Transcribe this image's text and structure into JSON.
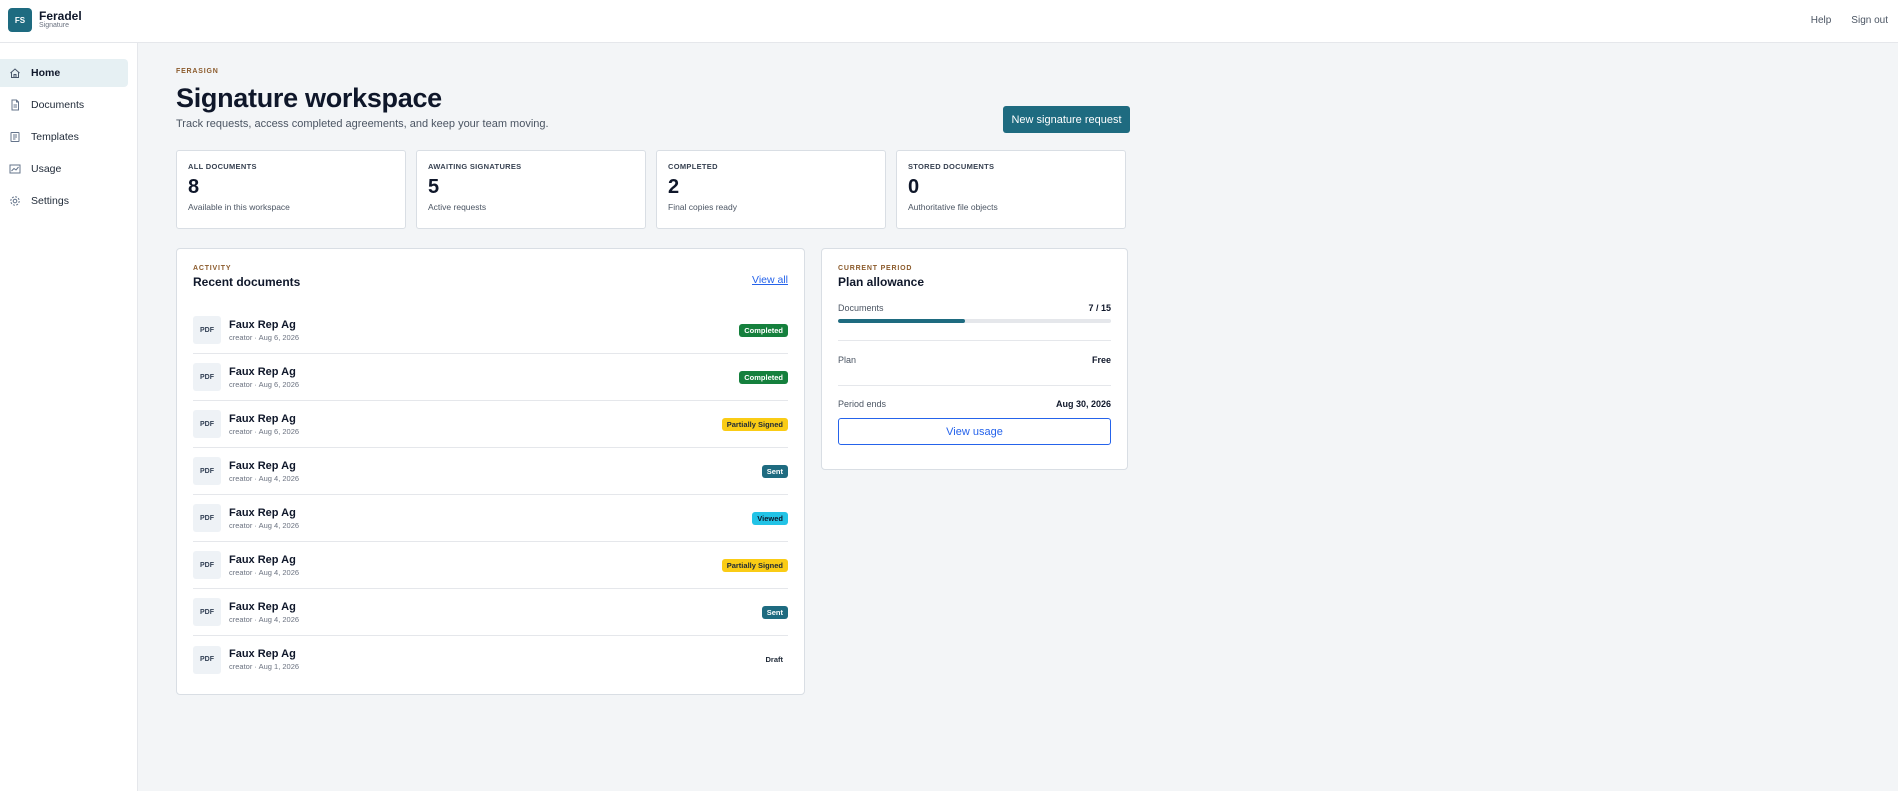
{
  "brand": {
    "logo": "FS",
    "name": "Feradel",
    "sub": "Signature"
  },
  "topnav": {
    "help": "Help",
    "signout": "Sign out"
  },
  "sidebar": {
    "items": [
      {
        "label": "Home",
        "icon": "home-icon",
        "active": true
      },
      {
        "label": "Documents",
        "icon": "document-icon",
        "active": false
      },
      {
        "label": "Templates",
        "icon": "template-icon",
        "active": false
      },
      {
        "label": "Usage",
        "icon": "chart-icon",
        "active": false
      },
      {
        "label": "Settings",
        "icon": "gear-icon",
        "active": false
      }
    ]
  },
  "header": {
    "eyebrow": "FERASIGN",
    "title": "Signature workspace",
    "subtitle": "Track requests, access completed agreements, and keep your team moving.",
    "new_button": "New signature request"
  },
  "stats": [
    {
      "label": "ALL DOCUMENTS",
      "value": "8",
      "caption": "Available in this workspace"
    },
    {
      "label": "AWAITING SIGNATURES",
      "value": "5",
      "caption": "Active requests"
    },
    {
      "label": "COMPLETED",
      "value": "2",
      "caption": "Final copies ready"
    },
    {
      "label": "STORED DOCUMENTS",
      "value": "0",
      "caption": "Authoritative file objects"
    }
  ],
  "activity": {
    "eyebrow": "ACTIVITY",
    "title": "Recent documents",
    "view_all": "View all",
    "documents": [
      {
        "icon": "PDF",
        "name": "Faux Rep Ag",
        "meta": "creator · Aug 6, 2026",
        "status": "Completed"
      },
      {
        "icon": "PDF",
        "name": "Faux Rep Ag",
        "meta": "creator · Aug 6, 2026",
        "status": "Completed"
      },
      {
        "icon": "PDF",
        "name": "Faux Rep Ag",
        "meta": "creator · Aug 6, 2026",
        "status": "Partially Signed"
      },
      {
        "icon": "PDF",
        "name": "Faux Rep Ag",
        "meta": "creator · Aug 4, 2026",
        "status": "Sent"
      },
      {
        "icon": "PDF",
        "name": "Faux Rep Ag",
        "meta": "creator · Aug 4, 2026",
        "status": "Viewed"
      },
      {
        "icon": "PDF",
        "name": "Faux Rep Ag",
        "meta": "creator · Aug 4, 2026",
        "status": "Partially Signed"
      },
      {
        "icon": "PDF",
        "name": "Faux Rep Ag",
        "meta": "creator · Aug 4, 2026",
        "status": "Sent"
      },
      {
        "icon": "PDF",
        "name": "Faux Rep Ag",
        "meta": "creator · Aug 1, 2026",
        "status": "Draft"
      }
    ]
  },
  "plan": {
    "eyebrow": "CURRENT PERIOD",
    "title": "Plan allowance",
    "documents_label": "Documents",
    "documents_value": "7 / 15",
    "usage_fraction": 0.4667,
    "plan_label": "Plan",
    "plan_value": "Free",
    "period_label": "Period ends",
    "period_value": "Aug 30, 2026",
    "button": "View usage"
  },
  "colors": {
    "accent": "#1e6b80",
    "eyebrow": "#8b5a2b",
    "link": "#2563eb",
    "completed": "#15803d",
    "partial": "#facc15",
    "viewed": "#22c3e6"
  }
}
